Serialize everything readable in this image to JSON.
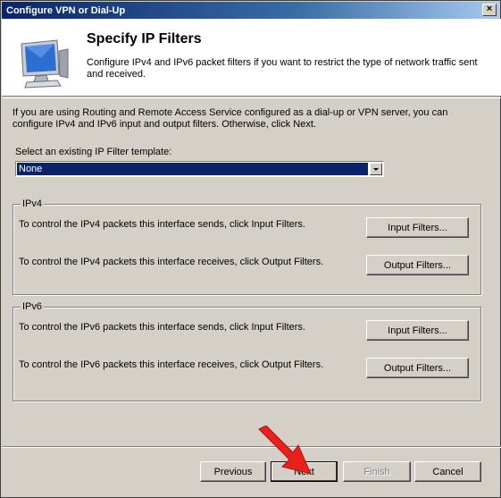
{
  "window": {
    "title": "Configure VPN or Dial-Up",
    "close_glyph": "×"
  },
  "header": {
    "title": "Specify IP Filters",
    "description": "Configure IPv4 and IPv6 packet filters if you want to restrict the type of network traffic sent and received."
  },
  "intro": "If you are using Routing and Remote Access Service configured as a dial-up or VPN server, you can configure IPv4 and IPv6 input and output filters. Otherwise, click Next.",
  "template": {
    "label": "Select an existing IP Filter template:",
    "value": "None"
  },
  "ipv4": {
    "label": "IPv4",
    "send_text": "To control the IPv4 packets this interface sends, click Input Filters.",
    "receive_text": "To control the IPv4 packets this interface receives, click Output Filters.",
    "input_button": "Input Filters...",
    "output_button": "Output Filters..."
  },
  "ipv6": {
    "label": "IPv6",
    "send_text": "To control the IPv6 packets this interface sends, click Input Filters.",
    "receive_text": "To control the IPv6 packets this interface receives, click Output Filters.",
    "input_button": "Input Filters...",
    "output_button": "Output Filters..."
  },
  "buttons": {
    "previous": "Previous",
    "next": "Next",
    "finish": "Finish",
    "cancel": "Cancel"
  },
  "colors": {
    "titlebar": "#0a246a",
    "selection": "#0a246a",
    "annotation_arrow": "#e8211c"
  },
  "icons": {
    "wizard": "computer-monitor-icon",
    "annotation": "red-arrow-icon"
  }
}
